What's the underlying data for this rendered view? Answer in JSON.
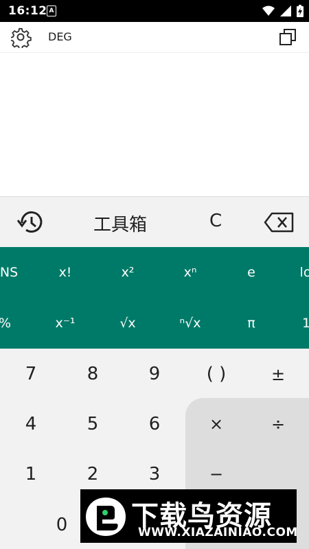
{
  "status": {
    "time": "16:12",
    "badge": "A"
  },
  "header": {
    "mode": "DEG"
  },
  "toolbar": {
    "toolbox": "工具箱",
    "clear": "C"
  },
  "sci": {
    "row1": [
      "NS",
      "x!",
      "x²",
      "xⁿ",
      "e",
      "lo"
    ],
    "row2": [
      "%",
      "x⁻¹",
      "√x",
      "ⁿ√x",
      "π",
      "1"
    ]
  },
  "keypad": {
    "row1": [
      "7",
      "8",
      "9",
      "( )",
      "±"
    ],
    "row2": [
      "4",
      "5",
      "6",
      "×",
      "÷"
    ],
    "row3": [
      "1",
      "2",
      "3",
      "−"
    ],
    "row4": [
      "0"
    ]
  },
  "watermark": {
    "title": "下载鸟资源",
    "url": "WWW.XIAZAINIAO.COM"
  },
  "colors": {
    "scientific_panel": "#007a68",
    "operator_panel": "#dddddd"
  }
}
